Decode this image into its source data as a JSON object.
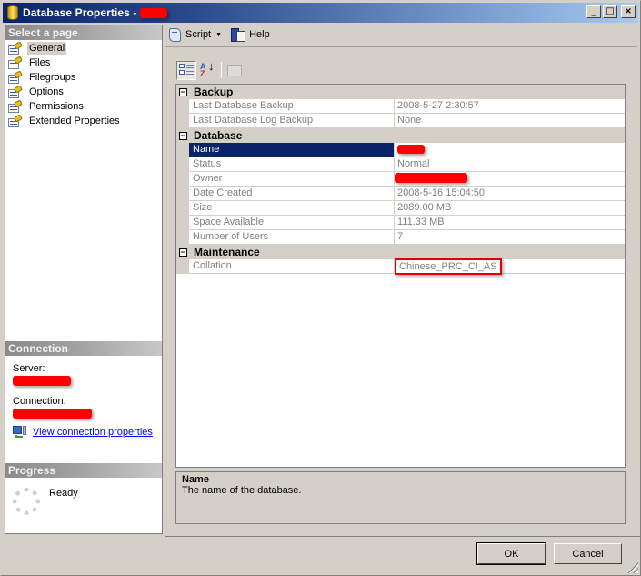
{
  "window": {
    "title": "Database Properties - ",
    "title_redacted": true,
    "controls": {
      "minimize": "_",
      "maximize": "□",
      "close": "×"
    }
  },
  "left_panel": {
    "select_page_header": "Select a page",
    "pages": [
      {
        "label": "General",
        "selected": true
      },
      {
        "label": "Files",
        "selected": false
      },
      {
        "label": "Filegroups",
        "selected": false
      },
      {
        "label": "Options",
        "selected": false
      },
      {
        "label": "Permissions",
        "selected": false
      },
      {
        "label": "Extended Properties",
        "selected": false
      }
    ],
    "connection": {
      "header": "Connection",
      "server_label": "Server:",
      "server_value_redacted": true,
      "connection_label": "Connection:",
      "connection_value_redacted": true,
      "link": "View connection properties"
    },
    "progress": {
      "header": "Progress",
      "status": "Ready"
    }
  },
  "toolbar": {
    "script_label": "Script",
    "help_label": "Help"
  },
  "property_grid": {
    "categories": [
      {
        "name": "Backup",
        "expanded": true,
        "properties": [
          {
            "name": "Last Database Backup",
            "value": "2008-5-27 2:30:57"
          },
          {
            "name": "Last Database Log Backup",
            "value": "None"
          }
        ]
      },
      {
        "name": "Database",
        "expanded": true,
        "properties": [
          {
            "name": "Name",
            "value": "",
            "redacted": true,
            "selected": true
          },
          {
            "name": "Status",
            "value": "Normal"
          },
          {
            "name": "Owner",
            "value": "",
            "redacted": true
          },
          {
            "name": "Date Created",
            "value": "2008-5-16 15:04:50"
          },
          {
            "name": "Size",
            "value": "2089.00 MB"
          },
          {
            "name": "Space Available",
            "value": "111.33 MB"
          },
          {
            "name": "Number of Users",
            "value": "7"
          }
        ]
      },
      {
        "name": "Maintenance",
        "expanded": true,
        "properties": [
          {
            "name": "Collation",
            "value": "Chinese_PRC_CI_AS",
            "highlighted": true
          }
        ]
      }
    ],
    "expander_symbol": "−"
  },
  "description": {
    "title": "Name",
    "text": "The name of the database."
  },
  "buttons": {
    "ok": "OK",
    "cancel": "Cancel"
  },
  "colors": {
    "selection": "#0a246a",
    "highlight_box": "#e00000",
    "redaction": "#ff0000",
    "link": "#0000ff"
  }
}
